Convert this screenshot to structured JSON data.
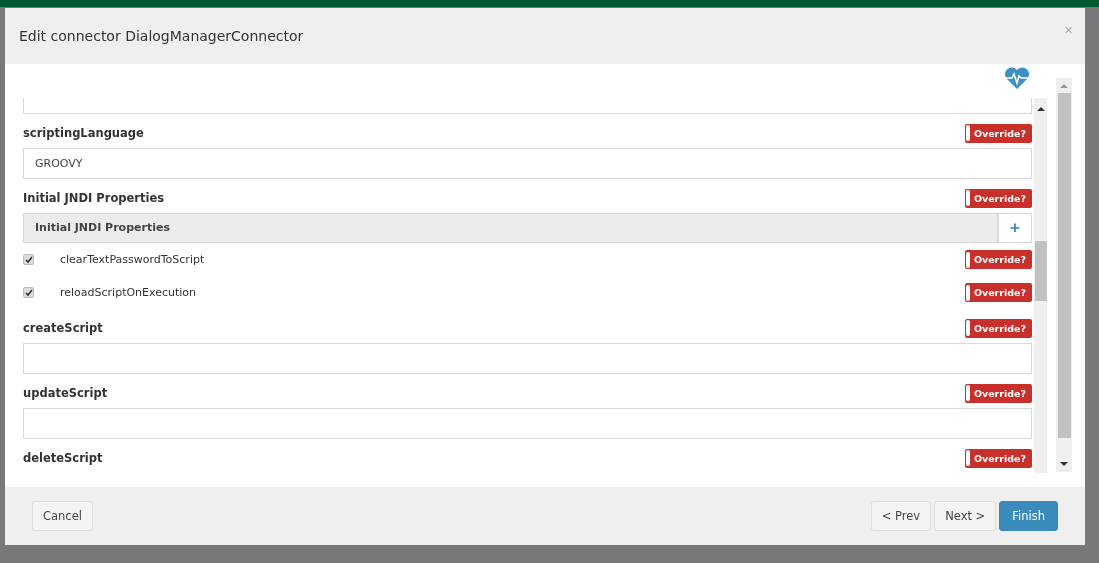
{
  "dialog": {
    "title": "Edit connector DialogManagerConnector",
    "close": "×"
  },
  "fields": [
    {
      "kind": "cut_input"
    },
    {
      "kind": "text",
      "label": "scriptingLanguage",
      "value": "GROOVY",
      "override": false,
      "override_label": "Override?"
    },
    {
      "kind": "map",
      "label": "Initial JNDI Properties",
      "header": "Initial JNDI Properties",
      "add": "+",
      "override": false,
      "override_label": "Override?"
    },
    {
      "kind": "checkbox",
      "label": "clearTextPasswordToScript",
      "checked": true,
      "override": false,
      "override_label": "Override?"
    },
    {
      "kind": "checkbox",
      "label": "reloadScriptOnExecution",
      "checked": true,
      "override": false,
      "override_label": "Override?"
    },
    {
      "kind": "text",
      "label": "createScript",
      "override": false,
      "override_label": "Override?"
    },
    {
      "kind": "text",
      "label": "updateScript",
      "override": false,
      "override_label": "Override?"
    },
    {
      "kind": "label",
      "label": "deleteScript",
      "override": false,
      "override_label": "Override?"
    }
  ],
  "footer": {
    "cancel": "Cancel",
    "prev": "< Prev",
    "next": "Next >",
    "finish": "Finish"
  }
}
